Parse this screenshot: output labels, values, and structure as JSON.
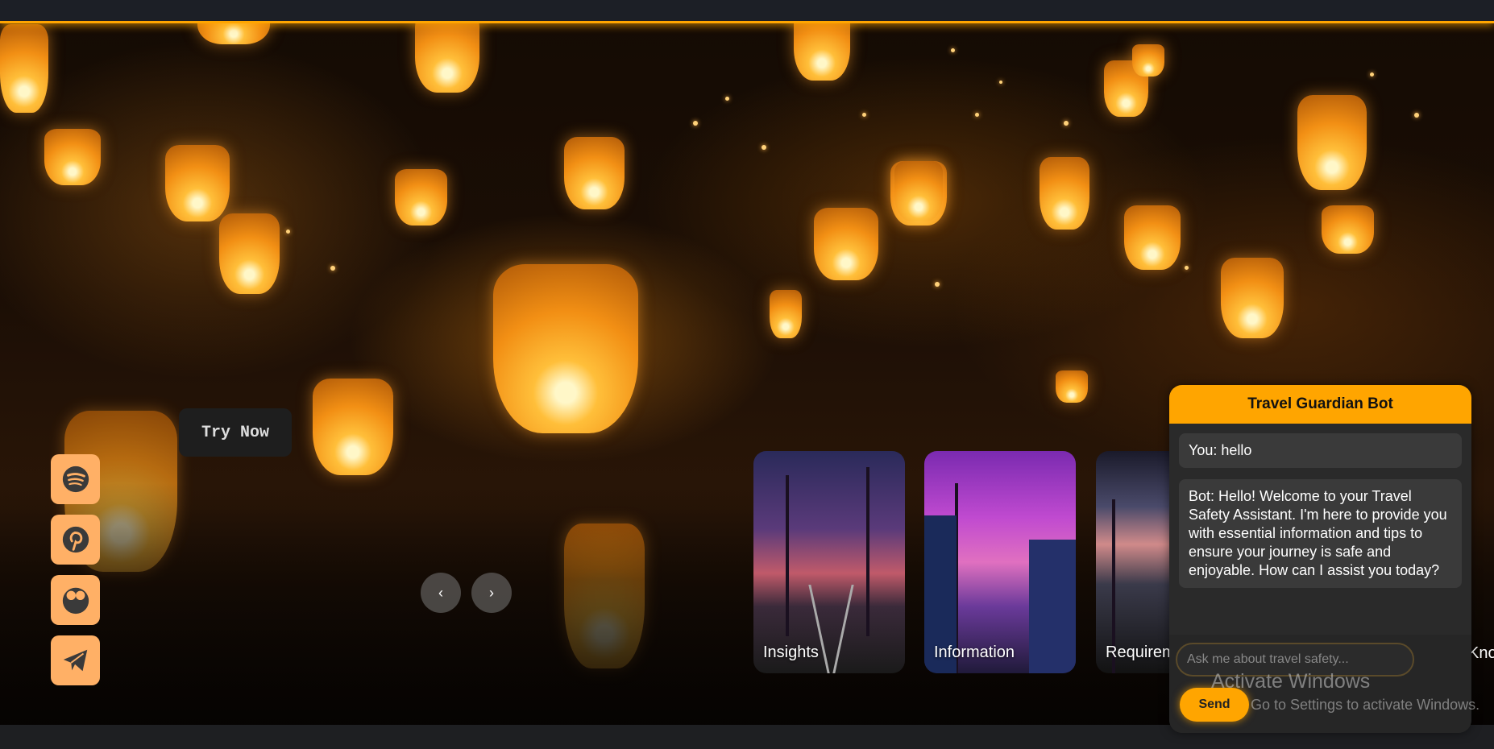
{
  "hero": {
    "try_now_label": "Try Now",
    "prev_arrow": "‹",
    "next_arrow": "›"
  },
  "socials": [
    {
      "name": "spotify-icon"
    },
    {
      "name": "pinterest-icon"
    },
    {
      "name": "zoom-lens-icon"
    },
    {
      "name": "telegram-icon"
    }
  ],
  "cards": [
    {
      "label": "Insights"
    },
    {
      "label": "Information"
    },
    {
      "label": "Requirements"
    },
    {
      "label": "Knowledge"
    }
  ],
  "chat": {
    "title": "Travel Guardian Bot",
    "messages": [
      {
        "text": "You: hello"
      },
      {
        "text": "Bot: Hello! Welcome to your Travel Safety Assistant. I'm here to provide you with essential information and tips to ensure your journey is safe and enjoyable. How can I assist you today?"
      }
    ],
    "input_placeholder": "Ask me about travel safety...",
    "send_label": "Send"
  },
  "watermark": {
    "line1": "Activate Windows",
    "line2": "Go to Settings to activate Windows."
  },
  "colors": {
    "accent": "#ffa500",
    "social_bg": "#ffb066",
    "topbar": "#1c1f26"
  }
}
